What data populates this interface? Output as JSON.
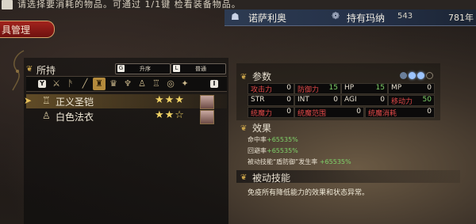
{
  "top_tip": "请选择要消耗的物品。可通过 1/1键 检看装备物品。",
  "character": {
    "name": "诺萨利奥",
    "holder_label": "持有玛纳",
    "holder_value": "543",
    "year": "781年"
  },
  "red_tab": "具管理",
  "inventory": {
    "title": "所持",
    "sort_key": "G",
    "sort_label": "升序",
    "view_key": "L",
    "view_label": "普通",
    "cat_left_key": "Y",
    "cat_right_key": "I",
    "categories": [
      "sword",
      "axe",
      "dagger",
      "helmet",
      "crown",
      "amulet",
      "robe",
      "armor",
      "ring",
      "misc"
    ],
    "active_category": 3,
    "items": [
      {
        "name": "正义圣铠",
        "stars": "★★★",
        "selected": true
      },
      {
        "name": "白色法衣",
        "stars": "★★☆",
        "selected": false
      }
    ]
  },
  "params": {
    "title": "参数",
    "rows": [
      [
        {
          "label": "攻击力",
          "value": "0"
        },
        {
          "label": "防御力",
          "value": "15",
          "green": true
        },
        {
          "label": "HP",
          "value": "15",
          "green": true
        },
        {
          "label": "MP",
          "value": "0"
        }
      ],
      [
        {
          "label": "STR",
          "value": "0"
        },
        {
          "label": "INT",
          "value": "0"
        },
        {
          "label": "AGI",
          "value": "0"
        },
        {
          "label": "移动力",
          "value": "50",
          "green": true
        }
      ],
      [
        {
          "label": "统魔力",
          "value": "0"
        },
        {
          "label": "统魔范围",
          "value": "0"
        },
        {
          "label": "统魔消耗",
          "value": "0"
        }
      ]
    ]
  },
  "effects": {
    "title": "效果",
    "lines": [
      {
        "label": "命中率",
        "value": "+65535%"
      },
      {
        "label": "回避率",
        "value": "+65535%"
      },
      {
        "label": "被动技能“盾防御”发生率",
        "value": "+65535%"
      }
    ]
  },
  "passive": {
    "title": "被动技能",
    "text": "免疫所有降低能力的效果和状态异常。"
  },
  "colors": {
    "accent_gold": "#c8a24a",
    "stat_red": "#e04848",
    "value_green": "#7fd36a",
    "tab_red": "#a3231d"
  }
}
